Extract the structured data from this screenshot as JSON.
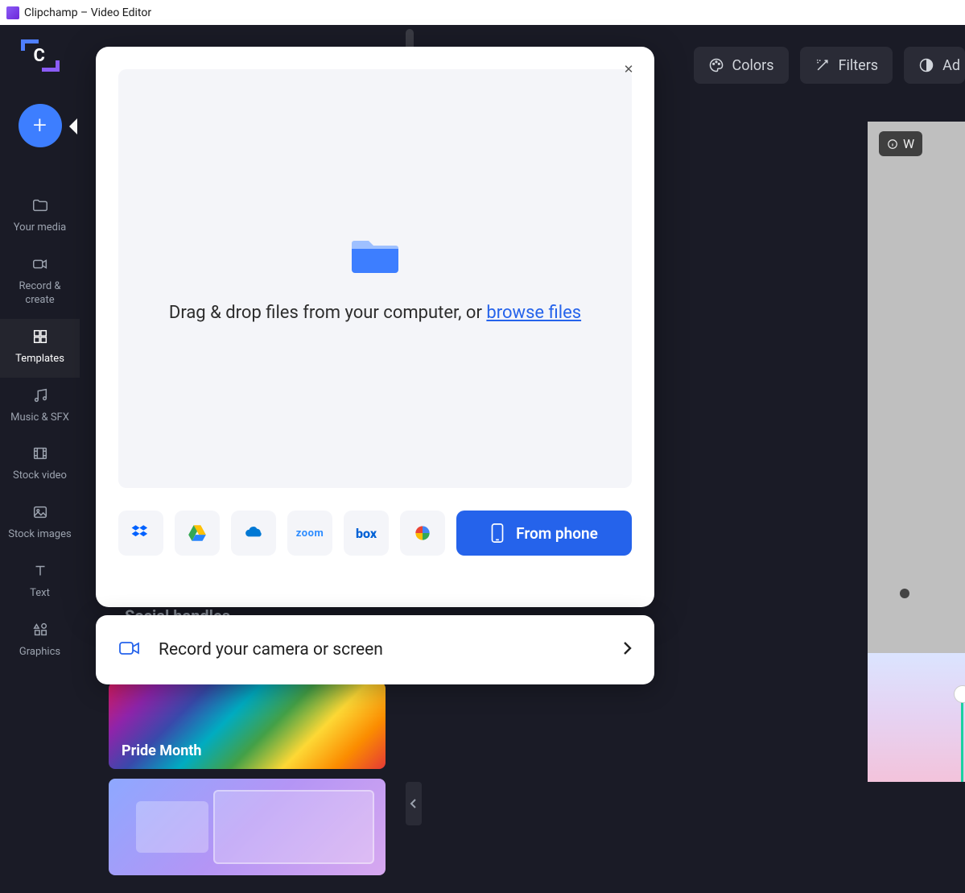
{
  "window": {
    "title": "Clipchamp – Video Editor"
  },
  "sidebar": {
    "items": [
      {
        "label": "Your media"
      },
      {
        "label": "Record & create"
      },
      {
        "label": "Templates"
      },
      {
        "label": "Music & SFX"
      },
      {
        "label": "Stock video"
      },
      {
        "label": "Stock images"
      },
      {
        "label": "Text"
      },
      {
        "label": "Graphics"
      }
    ],
    "active_index": 2
  },
  "toolbar": {
    "colors": "Colors",
    "filters": "Filters",
    "adjust": "Ad"
  },
  "preview": {
    "badge_text": "W"
  },
  "template_cards": {
    "social_handles": "Social handles",
    "pride_month": "Pride Month"
  },
  "import_modal": {
    "drop_text_prefix": "Drag & drop files from your computer, or ",
    "browse_link": "browse files",
    "sources": {
      "dropbox": "dropbox-icon",
      "google_drive": "google-drive-icon",
      "onedrive": "onedrive-icon",
      "zoom": "zoom",
      "box": "box",
      "google_photos": "google-photos-icon"
    },
    "from_phone": "From phone"
  },
  "record_bar": {
    "label": "Record your camera or screen"
  }
}
